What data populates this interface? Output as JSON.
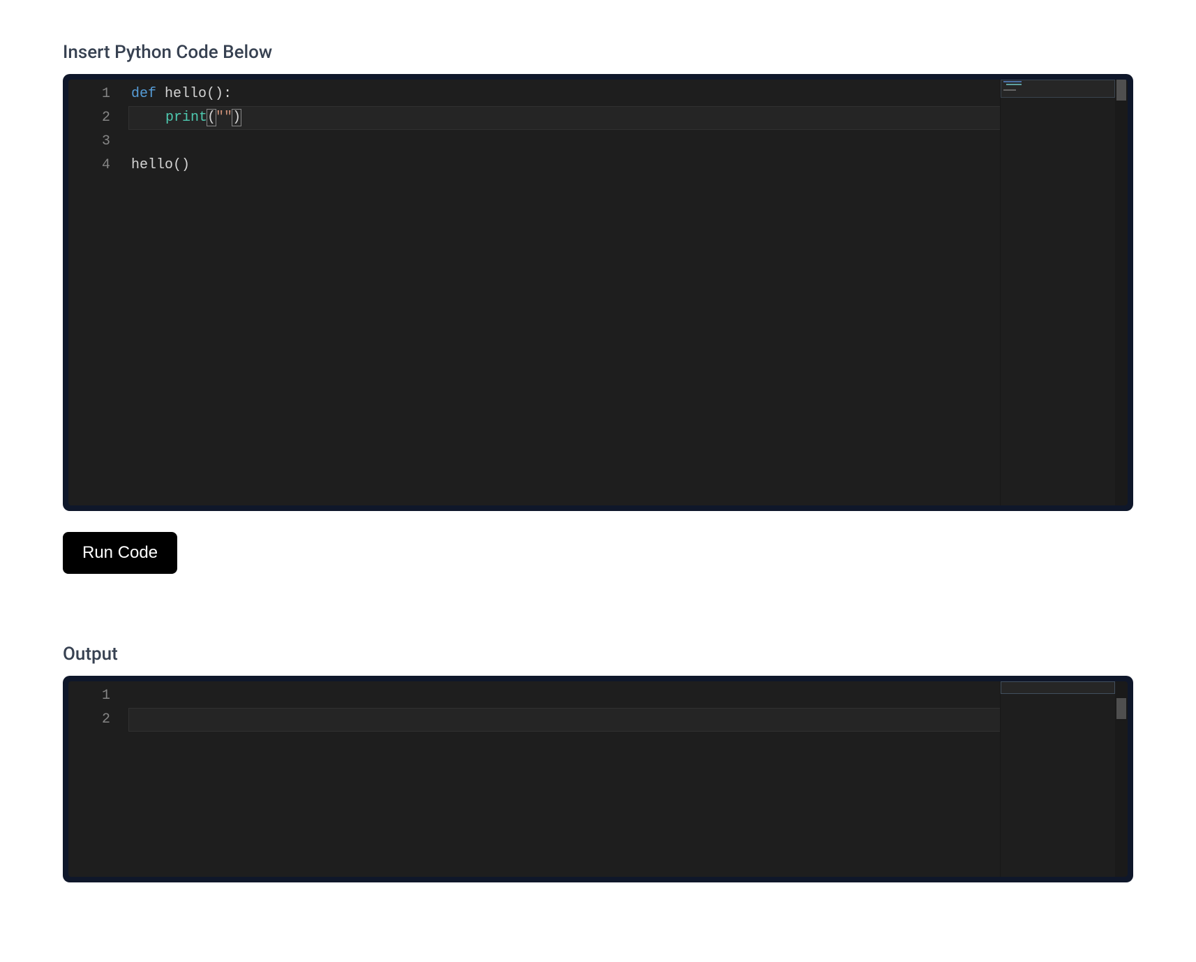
{
  "editor": {
    "label": "Insert Python Code Below",
    "lineNumbers": [
      "1",
      "2",
      "3",
      "4"
    ],
    "code": {
      "line1": {
        "keyword": "def",
        "space": " ",
        "funcname": "hello",
        "parens": "()",
        "colon": ":"
      },
      "line2": {
        "indent": "    ",
        "builtin": "print",
        "openParen": "(",
        "string": "\"\"",
        "closeParen": ")"
      },
      "line3": "",
      "line4": {
        "call": "hello",
        "parens": "()"
      }
    }
  },
  "runButton": {
    "label": "Run Code"
  },
  "output": {
    "label": "Output",
    "lineNumbers": [
      "1",
      "2"
    ],
    "lines": [
      "",
      ""
    ]
  }
}
